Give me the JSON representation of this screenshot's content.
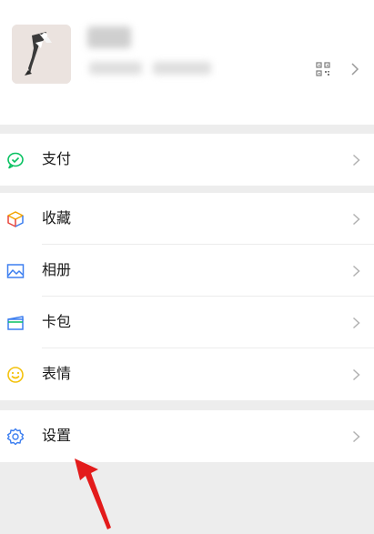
{
  "profile": {
    "avatar_icon": "cat-avatar-icon",
    "qr_icon": "qr-code-icon",
    "chevron_icon": "chevron-right-icon"
  },
  "menu": {
    "pay": {
      "label": "支付",
      "icon": "wallet-icon",
      "color": "#07c160"
    },
    "favorites": {
      "label": "收藏",
      "icon": "cube-icon"
    },
    "album": {
      "label": "相册",
      "icon": "picture-icon",
      "color": "#3d7ff0"
    },
    "cards": {
      "label": "卡包",
      "icon": "card-icon",
      "color": "#3d7ff0"
    },
    "stickers": {
      "label": "表情",
      "icon": "smiley-icon",
      "color": "#f4c20d"
    },
    "settings": {
      "label": "设置",
      "icon": "gear-icon",
      "color": "#3d7ff0"
    }
  },
  "annotation": {
    "icon": "red-arrow-icon",
    "color": "#e31b1b"
  }
}
